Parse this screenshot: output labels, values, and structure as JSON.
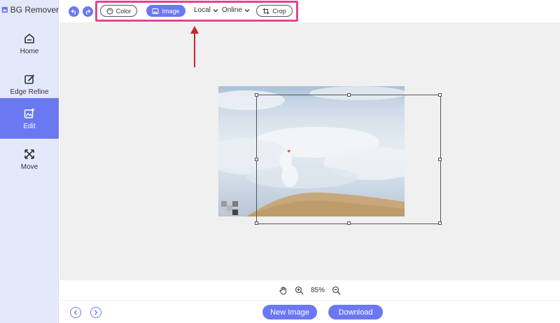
{
  "app": {
    "title": "BG Remover"
  },
  "sidebar": {
    "items": [
      {
        "label": "Home",
        "icon": "home-icon"
      },
      {
        "label": "Edge Refine",
        "icon": "edit-pen-icon"
      },
      {
        "label": "Edit",
        "icon": "image-edit-icon",
        "active": true
      },
      {
        "label": "Move",
        "icon": "move-arrows-icon"
      }
    ]
  },
  "toolbar": {
    "undo_icon": "undo-icon",
    "redo_icon": "redo-icon",
    "color_label": "Color",
    "image_label": "Image",
    "local_label": "Local",
    "online_label": "Online",
    "crop_label": "Crop"
  },
  "zoom": {
    "level": "85%"
  },
  "bottom": {
    "new_image_label": "New Image",
    "download_label": "Download"
  },
  "colors": {
    "accent": "#6a78f2",
    "sidebar_bg": "#e4e8fb",
    "highlight": "#e0468f",
    "arrow": "#cc2233"
  }
}
